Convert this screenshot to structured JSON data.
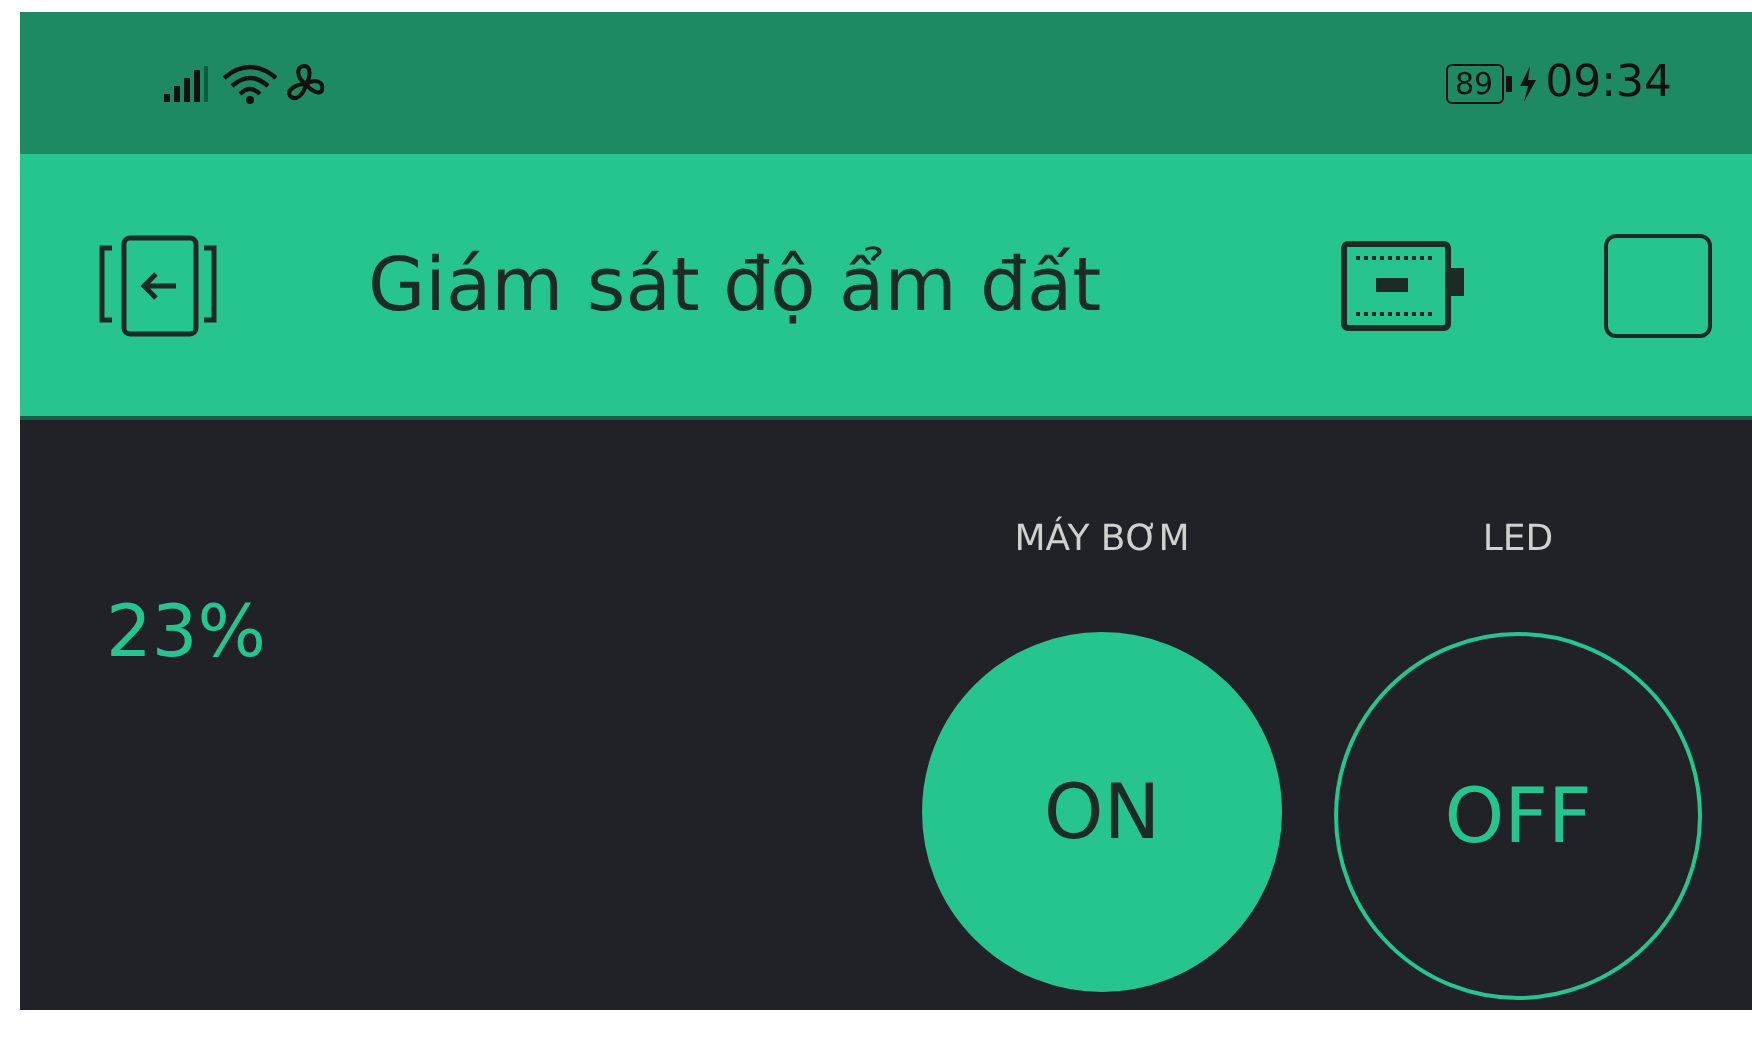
{
  "status_bar": {
    "battery": "89",
    "time": "09:34"
  },
  "app_bar": {
    "title": "Giám sát độ ẩm đất"
  },
  "moisture": {
    "value": "23%"
  },
  "buttons": [
    {
      "label": "MÁY BƠM",
      "text": "ON",
      "on": true
    },
    {
      "label": "LED",
      "text": "OFF",
      "on": false
    }
  ]
}
